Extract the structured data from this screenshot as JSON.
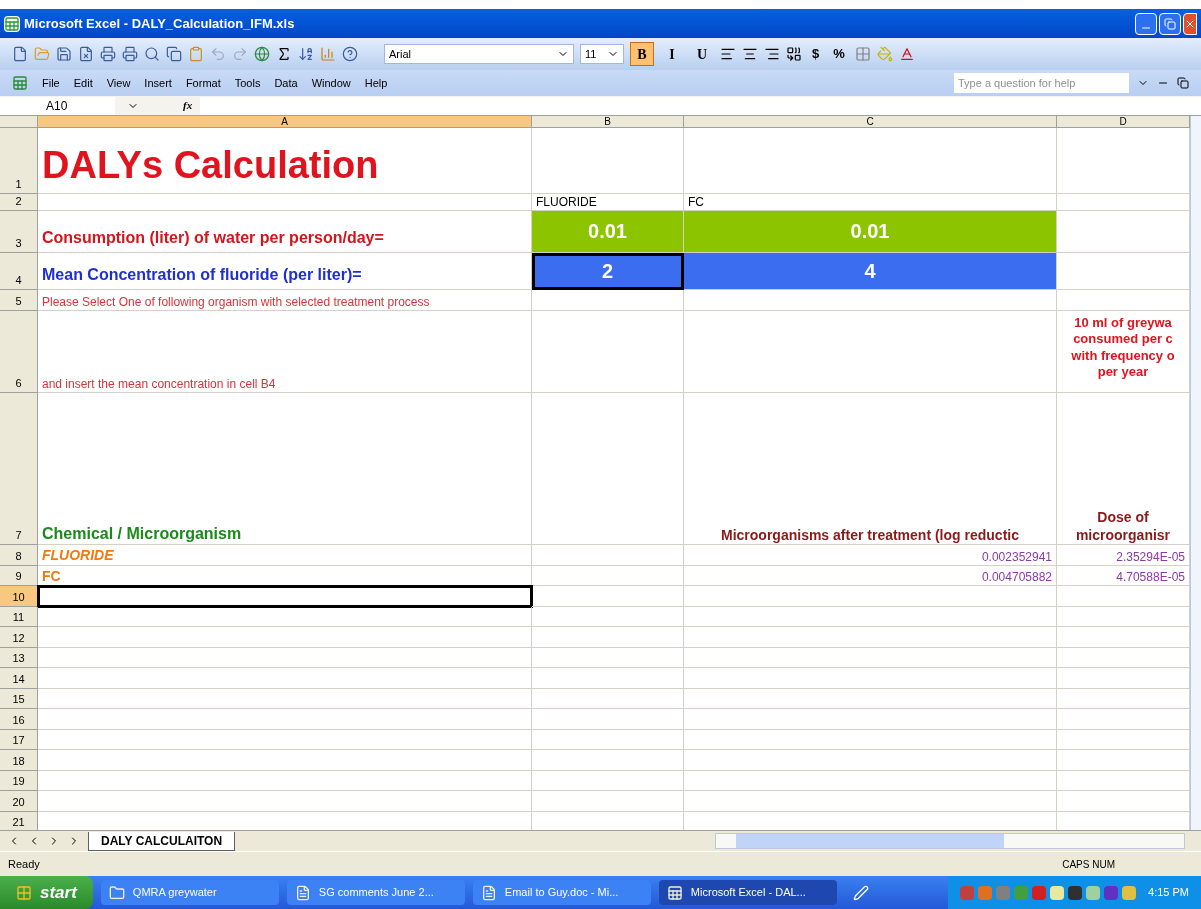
{
  "window": {
    "title": "Microsoft Excel - DALY_Calculation_IFM.xls"
  },
  "toolbar": {
    "font": "Arial",
    "font_size": "11",
    "format_buttons": [
      {
        "label": "B",
        "selected": true
      },
      {
        "label": "I",
        "selected": false
      },
      {
        "label": "U",
        "selected": false
      }
    ],
    "currency": "$",
    "percent": "%"
  },
  "menu": {
    "items": [
      "File",
      "Edit",
      "View",
      "Insert",
      "Format",
      "Tools",
      "Data",
      "Window",
      "Help"
    ],
    "help_box": {
      "placeholder": "Type a question for help"
    }
  },
  "formula_bar": {
    "name_box": "A10",
    "fx": "fx"
  },
  "columns": [
    {
      "label": "A",
      "selected": true
    },
    {
      "label": "B",
      "selected": false
    },
    {
      "label": "C",
      "selected": false
    },
    {
      "label": "D",
      "selected": false
    }
  ],
  "rows": [
    {
      "header": "1",
      "selected": false,
      "cells": {
        "a": {
          "text": "DALYs Calculation",
          "kind": "title"
        }
      }
    },
    {
      "header": "2",
      "selected": false,
      "cells": {
        "b": {
          "text": "FLUORIDE",
          "kind": "plain"
        },
        "c": {
          "text": "FC",
          "kind": "plain"
        }
      }
    },
    {
      "header": "3",
      "selected": false,
      "cells": {
        "a": {
          "text": "Consumption (liter) of water per person/day=",
          "kind": "label_red"
        },
        "b": {
          "text": "0.01",
          "kind": "value",
          "color": "#8dc400"
        },
        "c": {
          "text": "0.01",
          "kind": "value",
          "color": "#8dc400"
        }
      }
    },
    {
      "header": "4",
      "selected": false,
      "cells": {
        "a": {
          "text": "Mean Concentration of fluoride (per liter)=",
          "kind": "label_blue"
        },
        "b": {
          "text": "2",
          "kind": "value",
          "color": "#3a6df0",
          "outlined": true
        },
        "c": {
          "text": "4",
          "kind": "value",
          "color": "#3a6df0"
        }
      }
    },
    {
      "header": "5",
      "selected": false,
      "cells": {
        "a": {
          "text": "Please Select One of following organism with selected treatment process",
          "kind": "note"
        }
      }
    },
    {
      "header": "6",
      "selected": false,
      "cells": {
        "a": {
          "text": "and insert the mean concentration in cell B4",
          "kind": "note"
        },
        "d": {
          "lines": [
            "10 ml of greywa",
            "consumed per c",
            "with frequency o",
            "per year"
          ],
          "kind": "caption"
        }
      }
    },
    {
      "header": "7",
      "selected": false,
      "cells": {
        "a": {
          "text": "Chemical / Microorganism",
          "kind": "heading_green"
        },
        "c": {
          "text": "Microorganisms after treatment (log reductic",
          "kind": "heading_red"
        },
        "d": {
          "lines": [
            "Dose of",
            "microorganisr"
          ],
          "kind": "heading_red"
        }
      }
    },
    {
      "header": "8",
      "selected": false,
      "cells": {
        "a": {
          "text": "FLUORIDE",
          "kind": "item_italic"
        },
        "c": {
          "text": "0.002352941",
          "kind": "number"
        },
        "d": {
          "text": "2.35294E-05",
          "kind": "number"
        }
      }
    },
    {
      "header": "9",
      "selected": false,
      "cells": {
        "a": {
          "text": "FC",
          "kind": "item"
        },
        "c": {
          "text": "0.004705882",
          "kind": "number"
        },
        "d": {
          "text": "4.70588E-05",
          "kind": "number"
        }
      }
    },
    {
      "header": "10",
      "selected": true,
      "cells": {
        "a": {
          "selected": true
        }
      }
    },
    {
      "header": "11",
      "selected": false,
      "cells": {}
    },
    {
      "header": "12",
      "selected": false,
      "cells": {}
    },
    {
      "header": "13",
      "selected": false,
      "cells": {}
    },
    {
      "header": "14",
      "selected": false,
      "cells": {}
    },
    {
      "header": "15",
      "selected": false,
      "cells": {}
    },
    {
      "header": "16",
      "selected": false,
      "cells": {}
    },
    {
      "header": "17",
      "selected": false,
      "cells": {}
    },
    {
      "header": "18",
      "selected": false,
      "cells": {}
    },
    {
      "header": "19",
      "selected": false,
      "cells": {}
    },
    {
      "header": "20",
      "selected": false,
      "cells": {}
    },
    {
      "header": "21",
      "selected": false,
      "cells": {}
    }
  ],
  "sheet_tabs": [
    {
      "label": "DALY CALCULAITON",
      "selected": true
    }
  ],
  "status_bar": {
    "text": "Ready",
    "indicators": "CAPS NUM"
  },
  "taskbar": {
    "start": "start",
    "items": [
      {
        "label": "QMRA greywater",
        "kind": "folder",
        "selected": false
      },
      {
        "label": "SG comments June 2...",
        "kind": "doc",
        "selected": false
      },
      {
        "label": "Email to Guy.doc - Mi...",
        "kind": "doc",
        "selected": false
      },
      {
        "label": "Microsoft Excel - DAL...",
        "kind": "sheet",
        "selected": true
      }
    ],
    "clock": "4:15 PM"
  }
}
